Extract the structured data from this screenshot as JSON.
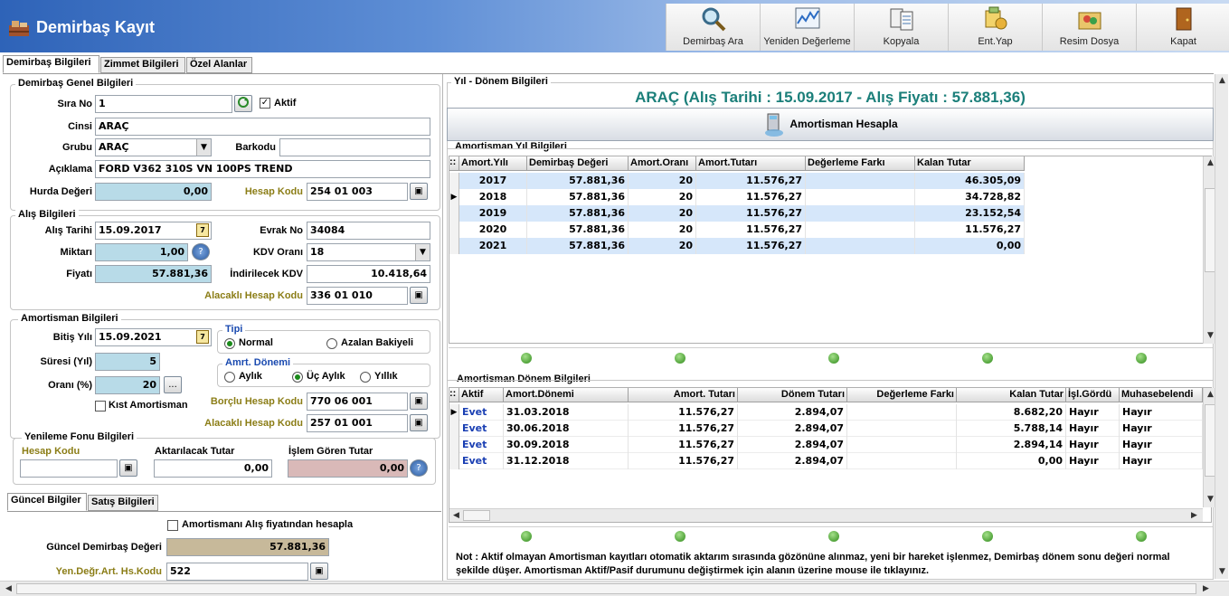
{
  "header": {
    "title": "Demirbaş Kayıt",
    "toolbar": [
      {
        "label": "Demirbaş Ara",
        "icon": "magnifier-icon"
      },
      {
        "label": "Yeniden Değerleme",
        "icon": "chart-icon"
      },
      {
        "label": "Kopyala",
        "icon": "copy-icon"
      },
      {
        "label": "Ent.Yap",
        "icon": "integration-icon"
      },
      {
        "label": "Resim Dosya",
        "icon": "image-folder-icon"
      },
      {
        "label": "Kapat",
        "icon": "door-exit-icon"
      }
    ]
  },
  "tabs": {
    "t1": "Demirbaş Bilgileri",
    "t2": "Zimmet Bilgileri",
    "t3": "Özel Alanlar"
  },
  "genel": {
    "title": "Demirbaş Genel Bilgileri",
    "sira_no_label": "Sıra No",
    "sira_no": "1",
    "aktif_label": "Aktif",
    "cinsi_label": "Cinsi",
    "cinsi": "ARAÇ",
    "grubu_label": "Grubu",
    "grubu": "ARAÇ",
    "barkodu_label": "Barkodu",
    "barkodu": "",
    "aciklama_label": "Açıklama",
    "aciklama": "FORD V362 310S VN 100PS TREND",
    "hurda_label": "Hurda Değeri",
    "hurda": "0,00",
    "hesap_label": "Hesap Kodu",
    "hesap": "254 01 003"
  },
  "alis": {
    "title": "Alış Bilgileri",
    "tarih_label": "Alış Tarihi",
    "tarih": "15.09.2017",
    "evrak_label": "Evrak No",
    "evrak": "34084",
    "miktar_label": "Miktarı",
    "miktar": "1,00",
    "kdv_label": "KDV Oranı",
    "kdv": "18",
    "fiyat_label": "Fiyatı",
    "fiyat": "57.881,36",
    "ind_kdv_label": "İndirilecek KDV",
    "ind_kdv": "10.418,64",
    "alacakli_label": "Alacaklı Hesap Kodu",
    "alacakli": "336 01 010"
  },
  "amort": {
    "title": "Amortisman Bilgileri",
    "bitis_label": "Bitiş Yılı",
    "bitis": "15.09.2021",
    "suresi_label": "Süresi (Yıl)",
    "suresi": "5",
    "orani_label": "Oranı (%)",
    "orani": "20",
    "kist_label": "Kıst Amortisman",
    "tipi_title": "Tipi",
    "normal": "Normal",
    "azalan": "Azalan Bakiyeli",
    "donem_title": "Amrt. Dönemi",
    "aylik": "Aylık",
    "uc_aylik": "Üç Aylık",
    "yillik": "Yıllık",
    "borclu_label": "Borçlu Hesap Kodu",
    "borclu": "770 06 001",
    "alacakli_label": "Alacaklı Hesap Kodu",
    "alacakli": "257 01 001"
  },
  "yenileme": {
    "title": "Yenileme Fonu Bilgileri",
    "hesap_label": "Hesap Kodu",
    "hesap": "",
    "aktarilacak_label": "Aktarılacak Tutar",
    "aktarilacak": "0,00",
    "islem_label": "İşlem Gören Tutar",
    "islem": "0,00"
  },
  "bottom_tabs": {
    "t1": "Güncel Bilgiler",
    "t2": "Satış Bilgileri"
  },
  "guncel": {
    "chk_label": "Amortismanı Alış fiyatından hesapla",
    "deger_label": "Güncel Demirbaş Değeri",
    "deger": "57.881,36",
    "yen_label": "Yen.Değr.Art. Hs.Kodu",
    "yen": "522"
  },
  "right": {
    "group_title": "Yıl - Dönem Bilgileri",
    "headline": "ARAÇ (Alış Tarihi : 15.09.2017 - Alış Fiyatı : 57.881,36)",
    "calc_button": "Amortisman Hesapla",
    "yil_title": "Amortisman Yıl Bilgileri",
    "yil_headers": [
      "Amort.Yılı",
      "Demirbaş Değeri",
      "Amort.Oranı",
      "Amort.Tutarı",
      "Değerleme Farkı",
      "Kalan Tutar"
    ],
    "yil_rows": [
      [
        "2017",
        "57.881,36",
        "20",
        "11.576,27",
        "",
        "46.305,09"
      ],
      [
        "2018",
        "57.881,36",
        "20",
        "11.576,27",
        "",
        "34.728,82"
      ],
      [
        "2019",
        "57.881,36",
        "20",
        "11.576,27",
        "",
        "23.152,54"
      ],
      [
        "2020",
        "57.881,36",
        "20",
        "11.576,27",
        "",
        "11.576,27"
      ],
      [
        "2021",
        "57.881,36",
        "20",
        "11.576,27",
        "",
        "0,00"
      ]
    ],
    "donem_title": "Amortisman Dönem Bilgileri",
    "donem_headers": [
      "Aktif",
      "Amort.Dönemi",
      "Amort. Tutarı",
      "Dönem Tutarı",
      "Değerleme Farkı",
      "Kalan Tutar",
      "İşl.Gördü",
      "Muhasebelendi"
    ],
    "donem_rows": [
      [
        "Evet",
        "31.03.2018",
        "11.576,27",
        "2.894,07",
        "",
        "8.682,20",
        "Hayır",
        "Hayır"
      ],
      [
        "Evet",
        "30.06.2018",
        "11.576,27",
        "2.894,07",
        "",
        "5.788,14",
        "Hayır",
        "Hayır"
      ],
      [
        "Evet",
        "30.09.2018",
        "11.576,27",
        "2.894,07",
        "",
        "2.894,14",
        "Hayır",
        "Hayır"
      ],
      [
        "Evet",
        "31.12.2018",
        "11.576,27",
        "2.894,07",
        "",
        "0,00",
        "Hayır",
        "Hayır"
      ]
    ],
    "note": "Not : Aktif olmayan Amortisman kayıtları otomatik aktarım sırasında gözönüne alınmaz, yeni bir hareket işlenmez, Demirbaş dönem sonu değeri normal şekilde düşer. Amortisman Aktif/Pasif durumunu değiştirmek için alanın üzerine mouse ile tıklayınız."
  },
  "colors": {
    "header_blue": "#2e63b8",
    "field_blue": "#b8dbe8",
    "headline_teal": "#1b7f7a",
    "row_blue": "#d6e7fa",
    "olive": "#8b7d16"
  }
}
